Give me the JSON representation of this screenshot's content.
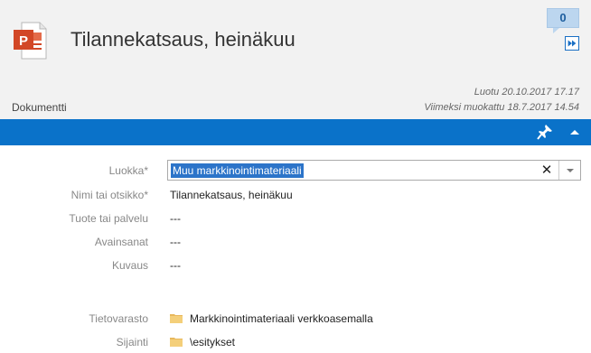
{
  "document": {
    "title": "Tilannekatsaus, heinäkuu",
    "type": "Dokumentti",
    "created": "Luotu 20.10.2017 17.17",
    "modified": "Viimeksi muokattu 18.7.2017 14.54",
    "icon": "powerpoint-file-icon"
  },
  "header": {
    "comment_count": "0"
  },
  "colors": {
    "accent": "#0a72c9",
    "header_bg": "#f2f2f2",
    "selection": "#2c74c9",
    "badge_bg": "#bcd6ef"
  },
  "fields": {
    "category": {
      "label": "Luokka*",
      "value": "Muu markkinointimateriaali"
    },
    "name": {
      "label": "Nimi tai otsikko*",
      "value": "Tilannekatsaus, heinäkuu"
    },
    "product": {
      "label": "Tuote tai palvelu",
      "value": "---"
    },
    "keywords": {
      "label": "Avainsanat",
      "value": "---"
    },
    "description": {
      "label": "Kuvaus",
      "value": "---"
    },
    "repository": {
      "label": "Tietovarasto",
      "value": "Markkinointimateriaali verkkoasemalla"
    },
    "location": {
      "label": "Sijainti",
      "value": "\\esitykset"
    }
  }
}
